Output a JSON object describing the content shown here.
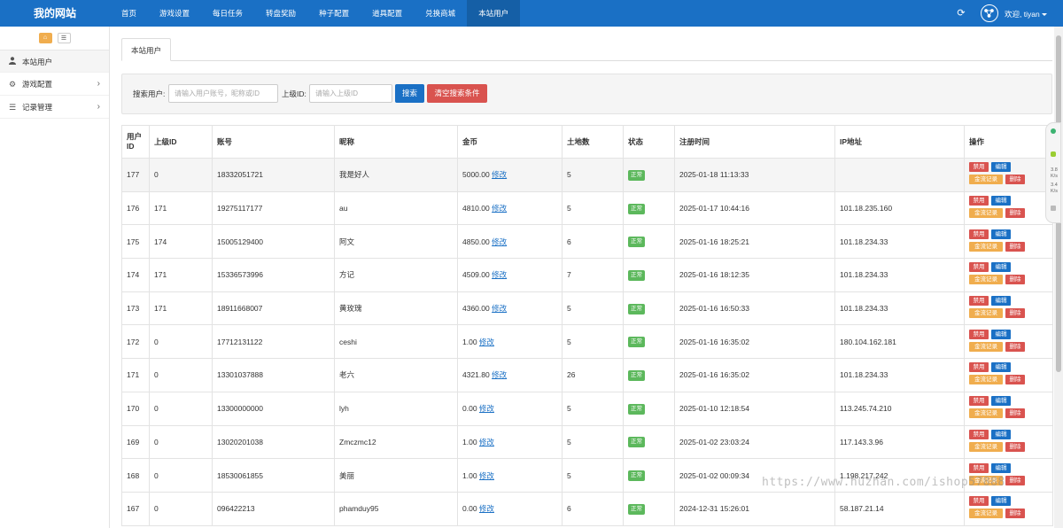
{
  "brand": "我的网站",
  "nav": [
    {
      "label": "首页"
    },
    {
      "label": "游戏设置"
    },
    {
      "label": "每日任务"
    },
    {
      "label": "转盘奖励"
    },
    {
      "label": "种子配置"
    },
    {
      "label": "道具配置"
    },
    {
      "label": "兑换商城"
    },
    {
      "label": "本站用户"
    }
  ],
  "nav_active_index": 7,
  "header": {
    "welcome": "欢迎, tiyan"
  },
  "sidebar": {
    "items": [
      {
        "label": "本站用户",
        "icon": "user-icon"
      },
      {
        "label": "游戏配置",
        "icon": "gears-icon"
      },
      {
        "label": "记录管理",
        "icon": "list-icon"
      }
    ]
  },
  "tab": {
    "label": "本站用户"
  },
  "search": {
    "user_label": "搜索用户:",
    "user_placeholder": "请输入用户账号，昵称或ID",
    "parent_label": "上级ID:",
    "parent_placeholder": "请输入上级ID",
    "search_button": "搜索",
    "clear_button": "清空搜索条件"
  },
  "table": {
    "headers": [
      "用户ID",
      "上级ID",
      "账号",
      "昵称",
      "金币",
      "土地数",
      "状态",
      "注册时间",
      "IP地址",
      "操作"
    ],
    "edit_label": "修改",
    "actions": {
      "ban": "禁用",
      "edit": "编辑",
      "flow": "金流记录",
      "delete": "删除"
    },
    "rows": [
      {
        "id": "177",
        "parent": "0",
        "account": "18332051721",
        "nickname": "我是好人",
        "coins": "5000.00",
        "land": "5",
        "status": "正常",
        "registered": "2025-01-18 11:13:33",
        "ip": ""
      },
      {
        "id": "176",
        "parent": "171",
        "account": "19275117177",
        "nickname": "au",
        "coins": "4810.00",
        "land": "5",
        "status": "正常",
        "registered": "2025-01-17 10:44:16",
        "ip": "101.18.235.160"
      },
      {
        "id": "175",
        "parent": "174",
        "account": "15005129400",
        "nickname": "阿文",
        "coins": "4850.00",
        "land": "6",
        "status": "正常",
        "registered": "2025-01-16 18:25:21",
        "ip": "101.18.234.33"
      },
      {
        "id": "174",
        "parent": "171",
        "account": "15336573996",
        "nickname": "方记",
        "coins": "4509.00",
        "land": "7",
        "status": "正常",
        "registered": "2025-01-16 18:12:35",
        "ip": "101.18.234.33"
      },
      {
        "id": "173",
        "parent": "171",
        "account": "18911668007",
        "nickname": "黄玫瑰",
        "coins": "4360.00",
        "land": "5",
        "status": "正常",
        "registered": "2025-01-16 16:50:33",
        "ip": "101.18.234.33"
      },
      {
        "id": "172",
        "parent": "0",
        "account": "17712131122",
        "nickname": "ceshi",
        "coins": "1.00",
        "land": "5",
        "status": "正常",
        "registered": "2025-01-16 16:35:02",
        "ip": "180.104.162.181"
      },
      {
        "id": "171",
        "parent": "0",
        "account": "13301037888",
        "nickname": "老六",
        "coins": "4321.80",
        "land": "26",
        "status": "正常",
        "registered": "2025-01-16 16:35:02",
        "ip": "101.18.234.33"
      },
      {
        "id": "170",
        "parent": "0",
        "account": "13300000000",
        "nickname": "lyh",
        "coins": "0.00",
        "land": "5",
        "status": "正常",
        "registered": "2025-01-10 12:18:54",
        "ip": "113.245.74.210"
      },
      {
        "id": "169",
        "parent": "0",
        "account": "13020201038",
        "nickname": "Zmczmc12",
        "coins": "1.00",
        "land": "5",
        "status": "正常",
        "registered": "2025-01-02 23:03:24",
        "ip": "117.143.3.96"
      },
      {
        "id": "168",
        "parent": "0",
        "account": "18530061855",
        "nickname": "美丽",
        "coins": "1.00",
        "land": "5",
        "status": "正常",
        "registered": "2025-01-02 00:09:34",
        "ip": "1.198.217.242"
      },
      {
        "id": "167",
        "parent": "0",
        "account": "096422213",
        "nickname": "phamduy95",
        "coins": "0.00",
        "land": "6",
        "status": "正常",
        "registered": "2024-12-31 15:26:01",
        "ip": "58.187.21.14"
      }
    ]
  },
  "widget": {
    "top": "3.8",
    "top_unit": "K/s",
    "bottom": "3.4",
    "bottom_unit": "K/s"
  },
  "watermark": "https://www.huzhan.com/ishop57888",
  "colors": {
    "primary": "#1a70c5",
    "danger": "#d9534f",
    "warning": "#f0ad4e",
    "success": "#5cb85c"
  }
}
